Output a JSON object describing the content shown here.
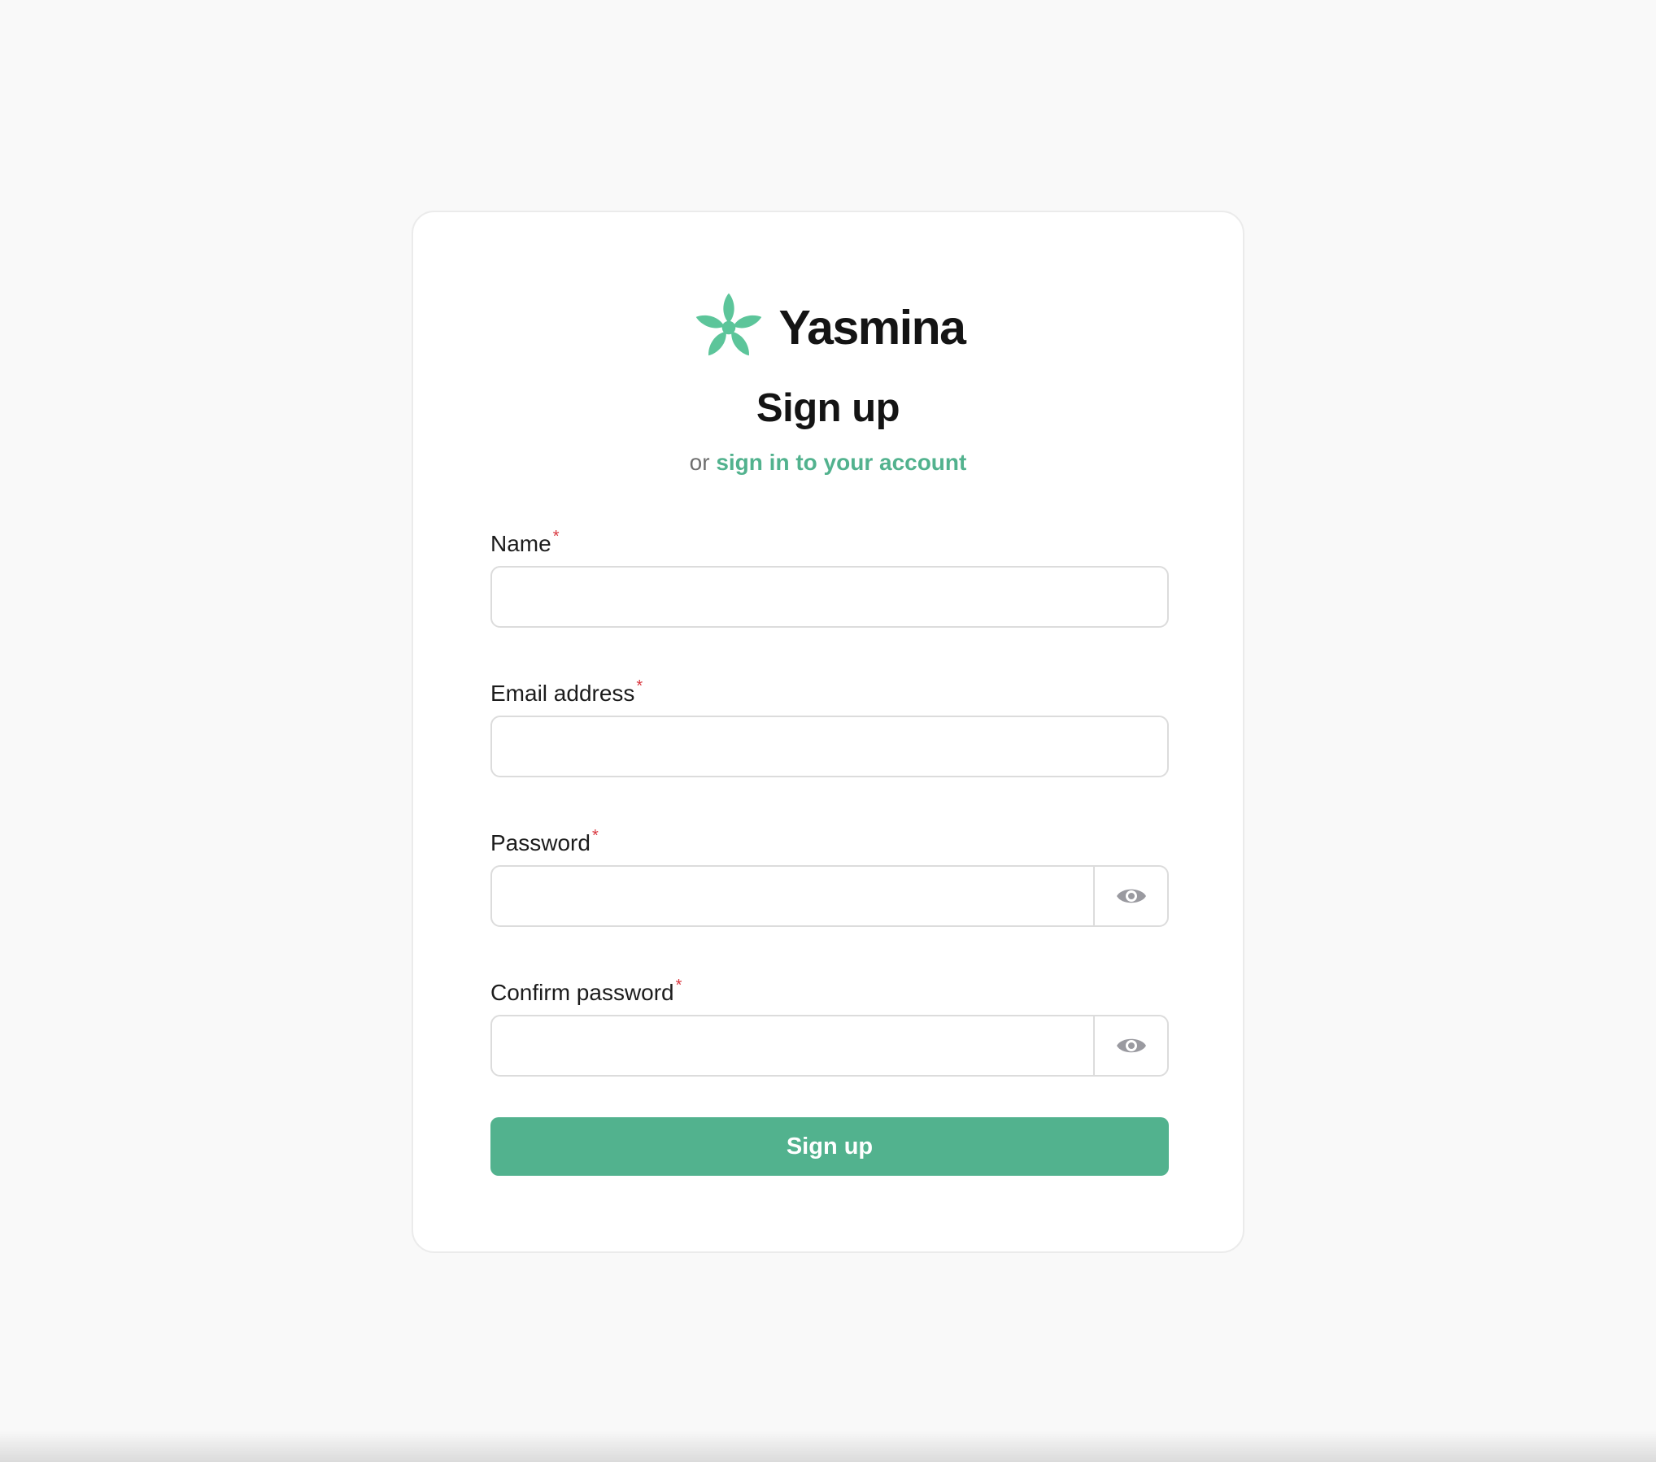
{
  "brand": {
    "name": "Yasmina",
    "logo_icon": "flower-icon",
    "logo_color": "#5cc59a"
  },
  "form": {
    "title": "Sign up",
    "subtitle_prefix": "or",
    "signin_link_text": "sign in to your account",
    "required_marker": "*",
    "fields": {
      "name": {
        "label": "Name",
        "value": "",
        "placeholder": ""
      },
      "email": {
        "label": "Email address",
        "value": "",
        "placeholder": ""
      },
      "password": {
        "label": "Password",
        "value": "",
        "placeholder": "",
        "toggle_icon": "eye-icon"
      },
      "confirm_password": {
        "label": "Confirm password",
        "value": "",
        "placeholder": "",
        "toggle_icon": "eye-icon"
      }
    },
    "submit_label": "Sign up"
  },
  "colors": {
    "accent": "#52b28e",
    "required": "#d9363e",
    "background": "#f9f9f9",
    "card": "#ffffff"
  }
}
